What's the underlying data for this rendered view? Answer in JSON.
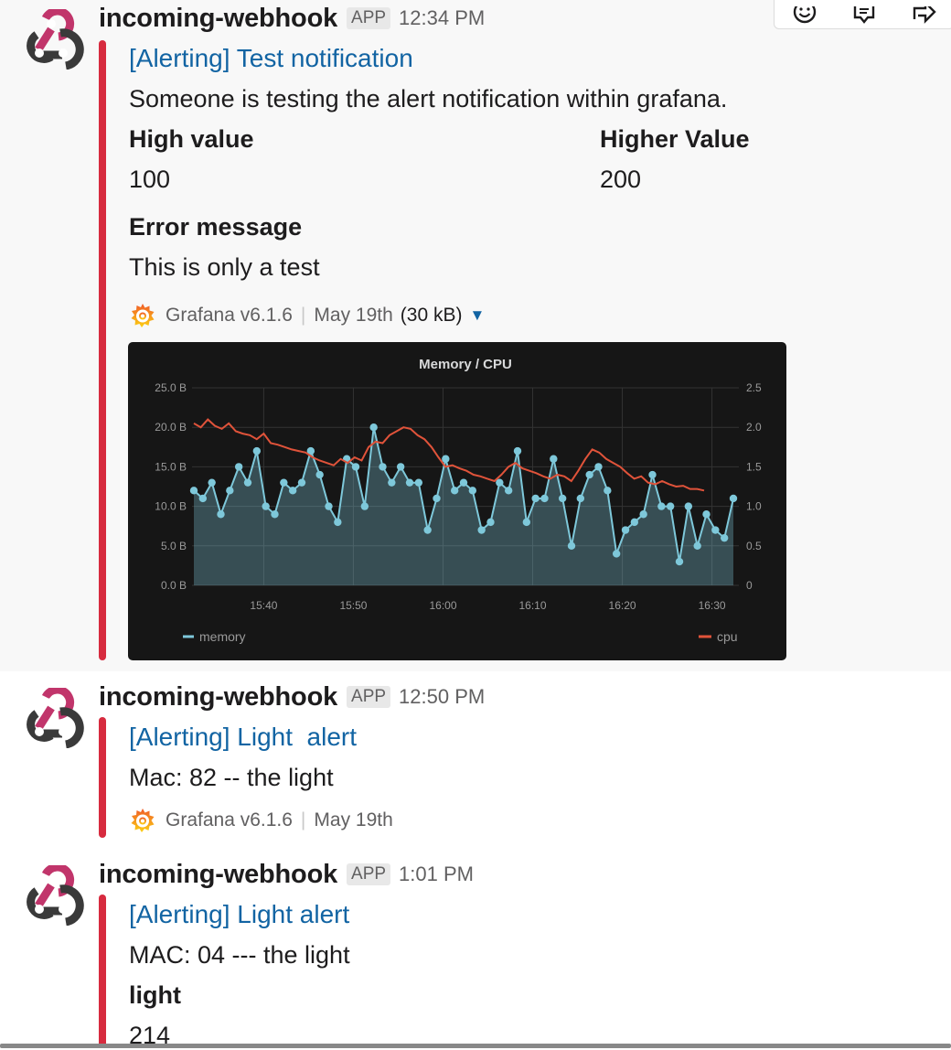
{
  "messages": [
    {
      "sender": "incoming-webhook",
      "badge": "APP",
      "time": "12:34 PM",
      "title": "[Alerting] Test notification",
      "text": "Someone is testing the alert notification within grafana.",
      "fields": [
        {
          "label": "High value",
          "value": "100"
        },
        {
          "label": "Higher Value",
          "value": "200"
        },
        {
          "label": "Error message",
          "value": "This is only a test"
        }
      ],
      "footer": {
        "source": "Grafana v6.1.6",
        "date": "May 19th",
        "size": "(30 kB)"
      }
    },
    {
      "sender": "incoming-webhook",
      "badge": "APP",
      "time": "12:50 PM",
      "title": "[Alerting] Light  alert",
      "text": "Mac: 82 -- the light",
      "footer": {
        "source": "Grafana v6.1.6",
        "date": "May 19th"
      }
    },
    {
      "sender": "incoming-webhook",
      "badge": "APP",
      "time": "1:01 PM",
      "title": "[Alerting] Light alert",
      "text": "MAC: 04 --- the light",
      "fields": [
        {
          "label": "light",
          "value": "214"
        }
      ]
    }
  ],
  "toolbar": [
    "emoji-reaction-icon",
    "thread-reply-icon",
    "share-message-icon"
  ],
  "colors": {
    "accent_bar": "#d72b3f",
    "link": "#1264a3",
    "memory": "#7ec8da",
    "cpu": "#e0533a"
  },
  "chart_data": {
    "type": "line",
    "title": "Memory / CPU",
    "x_labels": [
      "15:40",
      "15:50",
      "16:00",
      "16:10",
      "16:20",
      "16:30"
    ],
    "x_range": [
      "15:32",
      "16:33"
    ],
    "y_left": {
      "ticks": [
        "0.0 B",
        "5.0 B",
        "10.0 B",
        "15.0 B",
        "20.0 B",
        "25.0 B"
      ],
      "range": [
        0,
        25
      ]
    },
    "y_right": {
      "ticks": [
        "0",
        "0.5",
        "1.0",
        "1.5",
        "2.0",
        "2.5"
      ],
      "range": [
        0,
        2.5
      ]
    },
    "grid": true,
    "legend_position": "bottom",
    "series": [
      {
        "name": "memory",
        "axis": "left",
        "fill": true,
        "points": true,
        "values": [
          12,
          11,
          13,
          9,
          12,
          15,
          13,
          17,
          10,
          9,
          13,
          12,
          13,
          17,
          14,
          10,
          8,
          16,
          15,
          10,
          20,
          15,
          13,
          15,
          13,
          13,
          7,
          11,
          16,
          12,
          13,
          12,
          7,
          8,
          13,
          12,
          17,
          8,
          11,
          11,
          16,
          11,
          5,
          11,
          14,
          15,
          12,
          4,
          7,
          8,
          9,
          14,
          10,
          10,
          3,
          10,
          5,
          9,
          7,
          6,
          11
        ]
      },
      {
        "name": "cpu",
        "axis": "right",
        "fill": false,
        "points": false,
        "values": [
          2.05,
          2.0,
          2.1,
          2.02,
          1.98,
          2.05,
          1.95,
          1.92,
          1.9,
          1.85,
          1.92,
          1.8,
          1.78,
          1.75,
          1.72,
          1.7,
          1.68,
          1.62,
          1.58,
          1.55,
          1.52,
          1.6,
          1.55,
          1.62,
          1.58,
          1.75,
          1.82,
          1.8,
          1.9,
          1.95,
          2.0,
          1.98,
          1.9,
          1.85,
          1.75,
          1.62,
          1.5,
          1.52,
          1.48,
          1.45,
          1.4,
          1.38,
          1.35,
          1.32,
          1.4,
          1.5,
          1.55,
          1.48,
          1.45,
          1.42,
          1.38,
          1.35,
          1.4,
          1.38,
          1.32,
          1.45,
          1.6,
          1.72,
          1.68,
          1.6,
          1.55,
          1.5,
          1.42,
          1.35,
          1.38,
          1.3,
          1.28,
          1.32,
          1.28,
          1.25,
          1.26,
          1.22,
          1.22,
          1.2
        ]
      }
    ]
  }
}
